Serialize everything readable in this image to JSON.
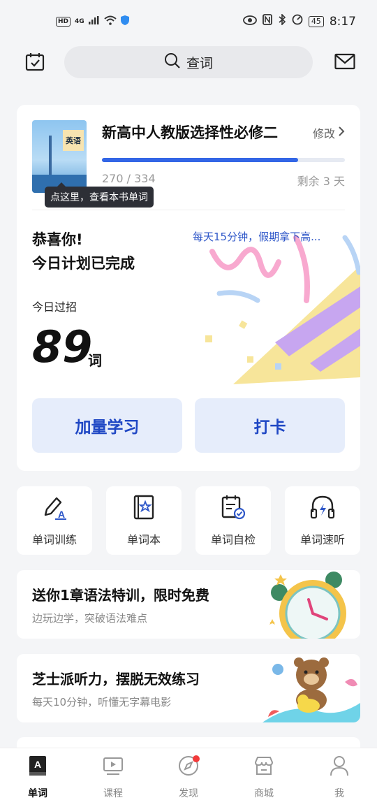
{
  "status_bar": {
    "left_badge": "HD",
    "network": "4G",
    "battery": "45",
    "time": "8:17"
  },
  "topbar": {
    "search_placeholder": "查词"
  },
  "book": {
    "cover_text": "英语",
    "name": "新高中人教版选择性必修二",
    "edit_label": "修改",
    "progress_text": "270 / 334",
    "progress_learned": 270,
    "progress_total": 334,
    "remaining": "剩余 3 天",
    "tooltip": "点这里，查看本书单词"
  },
  "plan": {
    "congrats_line1": "恭喜你!",
    "congrats_line2": "今日计划已完成",
    "promo_link": "每天15分钟，假期拿下高...",
    "today_label": "今日过招",
    "count": "89",
    "count_unit": "词",
    "more_button": "加量学习",
    "checkin_button": "打卡"
  },
  "tools": [
    {
      "label": "单词训练",
      "icon": "pencil-icon"
    },
    {
      "label": "单词本",
      "icon": "bookmark-star-icon"
    },
    {
      "label": "单词自检",
      "icon": "clipboard-check-icon"
    },
    {
      "label": "单词速听",
      "icon": "headphones-icon"
    }
  ],
  "banners": [
    {
      "title": "送你1章语法特训，限时免费",
      "subtitle": "边玩边学，突破语法难点",
      "icon": "alarm-clock-icon"
    },
    {
      "title": "芝士派听力，摆脱无效练习",
      "subtitle": "每天10分钟，听懂无字幕电影",
      "icon": "bear-mascot-icon"
    }
  ],
  "bottom_nav": [
    {
      "label": "单词",
      "icon": "book-a-icon",
      "active": true
    },
    {
      "label": "课程",
      "icon": "video-icon",
      "active": false
    },
    {
      "label": "发现",
      "icon": "compass-icon",
      "active": false,
      "badge": true
    },
    {
      "label": "商城",
      "icon": "store-icon",
      "active": false
    },
    {
      "label": "我",
      "icon": "person-icon",
      "active": false
    }
  ],
  "colors": {
    "accent": "#3366e6",
    "button_bg": "#e6edfb",
    "button_text": "#1f47c4",
    "badge": "#f23a3a"
  }
}
